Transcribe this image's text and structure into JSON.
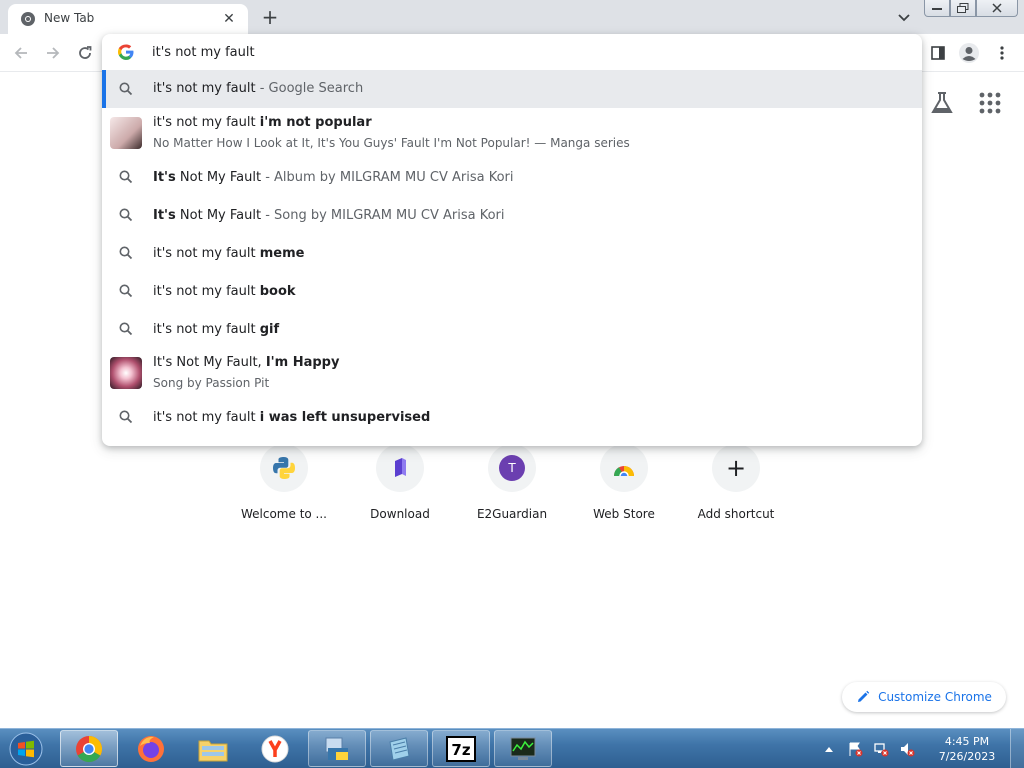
{
  "tab": {
    "title": "New Tab",
    "close_glyph": "✕"
  },
  "newtab_glyph": "+",
  "omnibox": {
    "value": "it's not my fault "
  },
  "suggestions": [
    {
      "kind": "search",
      "prefix": "it's not my fault",
      "bold": "",
      "suffix": " - Google Search"
    },
    {
      "kind": "entity",
      "prefix": "it's not my fault ",
      "bold": "i'm not popular",
      "suffix": "",
      "subtitle": "No Matter How I Look at It, It's You Guys' Fault I'm Not Popular! — Manga series"
    },
    {
      "kind": "search",
      "bold_lead": "It's",
      "prefix": " Not My Fault",
      "suffix": " - Album by MILGRAM MU CV Arisa Kori"
    },
    {
      "kind": "search",
      "bold_lead": "It's",
      "prefix": " Not My Fault",
      "suffix": " - Song by MILGRAM MU CV Arisa Kori"
    },
    {
      "kind": "search",
      "prefix": "it's not my fault ",
      "bold": "meme"
    },
    {
      "kind": "search",
      "prefix": "it's not my fault ",
      "bold": "book"
    },
    {
      "kind": "search",
      "prefix": "it's not my fault ",
      "bold": "gif"
    },
    {
      "kind": "entity",
      "prefix": "It's Not My Fault, ",
      "bold": "I'm Happy",
      "subtitle": "Song by Passion Pit"
    },
    {
      "kind": "search",
      "prefix": "it's not my fault ",
      "bold": "i was left unsupervised"
    }
  ],
  "shortcuts": [
    {
      "label": "Welcome to ...",
      "icon": "python-icon"
    },
    {
      "label": "Download",
      "icon": "download-site-icon"
    },
    {
      "label": "E2Guardian",
      "icon": "e2guardian-icon",
      "letter": "T"
    },
    {
      "label": "Web Store",
      "icon": "web-store-icon"
    },
    {
      "label": "Add shortcut",
      "icon": "plus-icon",
      "glyph": "+"
    }
  ],
  "customize_label": "Customize Chrome",
  "clock": {
    "time": "4:45 PM",
    "date": "7/26/2023"
  },
  "colors": {
    "accent": "#1a73e8",
    "selected_row": "#e8eaed",
    "taskbar": "#3f74a8"
  }
}
